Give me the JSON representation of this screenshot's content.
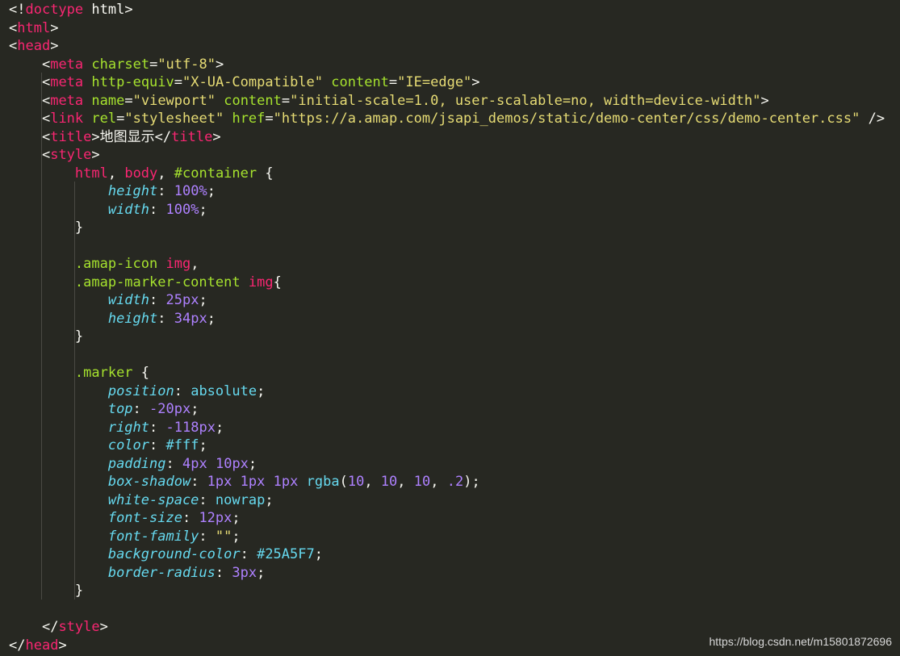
{
  "editor": {
    "lines": [
      [
        [
          "punct",
          "<!"
        ],
        [
          "tag",
          "doctype"
        ],
        [
          "text",
          " html"
        ],
        [
          "punct",
          ">"
        ]
      ],
      [
        [
          "punct",
          "<"
        ],
        [
          "tag",
          "html"
        ],
        [
          "punct",
          ">"
        ]
      ],
      [
        [
          "punct",
          "<"
        ],
        [
          "tag",
          "head"
        ],
        [
          "punct",
          ">"
        ]
      ],
      [
        [
          "text",
          "    "
        ],
        [
          "punct",
          "<"
        ],
        [
          "tag",
          "meta"
        ],
        [
          "text",
          " "
        ],
        [
          "attr",
          "charset"
        ],
        [
          "punct",
          "="
        ],
        [
          "str",
          "\"utf-8\""
        ],
        [
          "punct",
          ">"
        ]
      ],
      [
        [
          "text",
          "    "
        ],
        [
          "punct",
          "<"
        ],
        [
          "tag",
          "meta"
        ],
        [
          "text",
          " "
        ],
        [
          "attr",
          "http-equiv"
        ],
        [
          "punct",
          "="
        ],
        [
          "str",
          "\"X-UA-Compatible\""
        ],
        [
          "text",
          " "
        ],
        [
          "attr",
          "content"
        ],
        [
          "punct",
          "="
        ],
        [
          "str",
          "\"IE=edge\""
        ],
        [
          "punct",
          ">"
        ]
      ],
      [
        [
          "text",
          "    "
        ],
        [
          "punct",
          "<"
        ],
        [
          "tag",
          "meta"
        ],
        [
          "text",
          " "
        ],
        [
          "attr",
          "name"
        ],
        [
          "punct",
          "="
        ],
        [
          "str",
          "\"viewport\""
        ],
        [
          "text",
          " "
        ],
        [
          "attr",
          "content"
        ],
        [
          "punct",
          "="
        ],
        [
          "str",
          "\"initial-scale=1.0, user-scalable=no, width=device-width\""
        ],
        [
          "punct",
          ">"
        ]
      ],
      [
        [
          "text",
          "    "
        ],
        [
          "punct",
          "<"
        ],
        [
          "tag",
          "link"
        ],
        [
          "text",
          " "
        ],
        [
          "attr",
          "rel"
        ],
        [
          "punct",
          "="
        ],
        [
          "str",
          "\"stylesheet\""
        ],
        [
          "text",
          " "
        ],
        [
          "attr",
          "href"
        ],
        [
          "punct",
          "="
        ],
        [
          "str",
          "\"https://a.amap.com/jsapi_demos/static/demo-center/css/demo-center.css\""
        ],
        [
          "text",
          " "
        ],
        [
          "punct",
          "/>"
        ]
      ],
      [
        [
          "text",
          "    "
        ],
        [
          "punct",
          "<"
        ],
        [
          "tag",
          "title"
        ],
        [
          "punct",
          ">"
        ],
        [
          "text",
          "地图显示"
        ],
        [
          "punct",
          "</"
        ],
        [
          "tag",
          "title"
        ],
        [
          "punct",
          ">"
        ]
      ],
      [
        [
          "text",
          "    "
        ],
        [
          "punct",
          "<"
        ],
        [
          "tag",
          "style"
        ],
        [
          "punct",
          ">"
        ]
      ],
      [
        [
          "text",
          "        "
        ],
        [
          "seltag",
          "html"
        ],
        [
          "punct",
          ", "
        ],
        [
          "seltag",
          "body"
        ],
        [
          "punct",
          ", "
        ],
        [
          "selid",
          "#container"
        ],
        [
          "text",
          " "
        ],
        [
          "punct",
          "{"
        ]
      ],
      [
        [
          "text",
          "            "
        ],
        [
          "prop",
          "height"
        ],
        [
          "punct",
          ": "
        ],
        [
          "num",
          "100"
        ],
        [
          "num",
          "%"
        ],
        [
          "punct",
          ";"
        ]
      ],
      [
        [
          "text",
          "            "
        ],
        [
          "prop",
          "width"
        ],
        [
          "punct",
          ": "
        ],
        [
          "num",
          "100"
        ],
        [
          "num",
          "%"
        ],
        [
          "punct",
          ";"
        ]
      ],
      [
        [
          "text",
          "        "
        ],
        [
          "punct",
          "}"
        ]
      ],
      [],
      [
        [
          "text",
          "        "
        ],
        [
          "selclass",
          ".amap-icon"
        ],
        [
          "text",
          " "
        ],
        [
          "seltag",
          "img"
        ],
        [
          "punct",
          ","
        ]
      ],
      [
        [
          "text",
          "        "
        ],
        [
          "selclass",
          ".amap-marker-content"
        ],
        [
          "text",
          " "
        ],
        [
          "seltag",
          "img"
        ],
        [
          "punct",
          "{"
        ]
      ],
      [
        [
          "text",
          "            "
        ],
        [
          "prop",
          "width"
        ],
        [
          "punct",
          ": "
        ],
        [
          "num",
          "25"
        ],
        [
          "num",
          "px"
        ],
        [
          "punct",
          ";"
        ]
      ],
      [
        [
          "text",
          "            "
        ],
        [
          "prop",
          "height"
        ],
        [
          "punct",
          ": "
        ],
        [
          "num",
          "34"
        ],
        [
          "num",
          "px"
        ],
        [
          "punct",
          ";"
        ]
      ],
      [
        [
          "text",
          "        "
        ],
        [
          "punct",
          "}"
        ]
      ],
      [],
      [
        [
          "text",
          "        "
        ],
        [
          "selclass",
          ".marker"
        ],
        [
          "text",
          " "
        ],
        [
          "punct",
          "{"
        ]
      ],
      [
        [
          "text",
          "            "
        ],
        [
          "prop",
          "position"
        ],
        [
          "punct",
          ": "
        ],
        [
          "val",
          "absolute"
        ],
        [
          "punct",
          ";"
        ]
      ],
      [
        [
          "text",
          "            "
        ],
        [
          "prop",
          "top"
        ],
        [
          "punct",
          ": "
        ],
        [
          "num",
          "-20"
        ],
        [
          "num",
          "px"
        ],
        [
          "punct",
          ";"
        ]
      ],
      [
        [
          "text",
          "            "
        ],
        [
          "prop",
          "right"
        ],
        [
          "punct",
          ": "
        ],
        [
          "num",
          "-118"
        ],
        [
          "num",
          "px"
        ],
        [
          "punct",
          ";"
        ]
      ],
      [
        [
          "text",
          "            "
        ],
        [
          "prop",
          "color"
        ],
        [
          "punct",
          ": "
        ],
        [
          "val",
          "#fff"
        ],
        [
          "punct",
          ";"
        ]
      ],
      [
        [
          "text",
          "            "
        ],
        [
          "prop",
          "padding"
        ],
        [
          "punct",
          ": "
        ],
        [
          "num",
          "4"
        ],
        [
          "num",
          "px"
        ],
        [
          "text",
          " "
        ],
        [
          "num",
          "10"
        ],
        [
          "num",
          "px"
        ],
        [
          "punct",
          ";"
        ]
      ],
      [
        [
          "text",
          "            "
        ],
        [
          "prop",
          "box-shadow"
        ],
        [
          "punct",
          ": "
        ],
        [
          "num",
          "1"
        ],
        [
          "num",
          "px"
        ],
        [
          "text",
          " "
        ],
        [
          "num",
          "1"
        ],
        [
          "num",
          "px"
        ],
        [
          "text",
          " "
        ],
        [
          "num",
          "1"
        ],
        [
          "num",
          "px"
        ],
        [
          "text",
          " "
        ],
        [
          "val",
          "rgba"
        ],
        [
          "punct",
          "("
        ],
        [
          "num",
          "10"
        ],
        [
          "punct",
          ", "
        ],
        [
          "num",
          "10"
        ],
        [
          "punct",
          ", "
        ],
        [
          "num",
          "10"
        ],
        [
          "punct",
          ", "
        ],
        [
          "num",
          ".2"
        ],
        [
          "punct",
          ");"
        ]
      ],
      [
        [
          "text",
          "            "
        ],
        [
          "prop",
          "white-space"
        ],
        [
          "punct",
          ": "
        ],
        [
          "val",
          "nowrap"
        ],
        [
          "punct",
          ";"
        ]
      ],
      [
        [
          "text",
          "            "
        ],
        [
          "prop",
          "font-size"
        ],
        [
          "punct",
          ": "
        ],
        [
          "num",
          "12"
        ],
        [
          "num",
          "px"
        ],
        [
          "punct",
          ";"
        ]
      ],
      [
        [
          "text",
          "            "
        ],
        [
          "prop",
          "font-family"
        ],
        [
          "punct",
          ": "
        ],
        [
          "str",
          "\"\""
        ],
        [
          "punct",
          ";"
        ]
      ],
      [
        [
          "text",
          "            "
        ],
        [
          "prop",
          "background-color"
        ],
        [
          "punct",
          ": "
        ],
        [
          "val",
          "#25A5F7"
        ],
        [
          "punct",
          ";"
        ]
      ],
      [
        [
          "text",
          "            "
        ],
        [
          "prop",
          "border-radius"
        ],
        [
          "punct",
          ": "
        ],
        [
          "num",
          "3"
        ],
        [
          "num",
          "px"
        ],
        [
          "punct",
          ";"
        ]
      ],
      [
        [
          "text",
          "        "
        ],
        [
          "punct",
          "}"
        ]
      ],
      [],
      [
        [
          "text",
          "    "
        ],
        [
          "punct",
          "</"
        ],
        [
          "tag",
          "style"
        ],
        [
          "punct",
          ">"
        ]
      ],
      [
        [
          "punct",
          "</"
        ],
        [
          "tag",
          "head"
        ],
        [
          "punct",
          ">"
        ]
      ]
    ]
  },
  "watermark": {
    "text": "https://blog.csdn.net/m15801872696"
  },
  "colors": {
    "background": "#272822",
    "tag": "#f92672",
    "attribute": "#a6e22e",
    "string": "#e6db74",
    "property": "#66d9ef",
    "number": "#ae81ff",
    "text": "#f8f8f2"
  }
}
